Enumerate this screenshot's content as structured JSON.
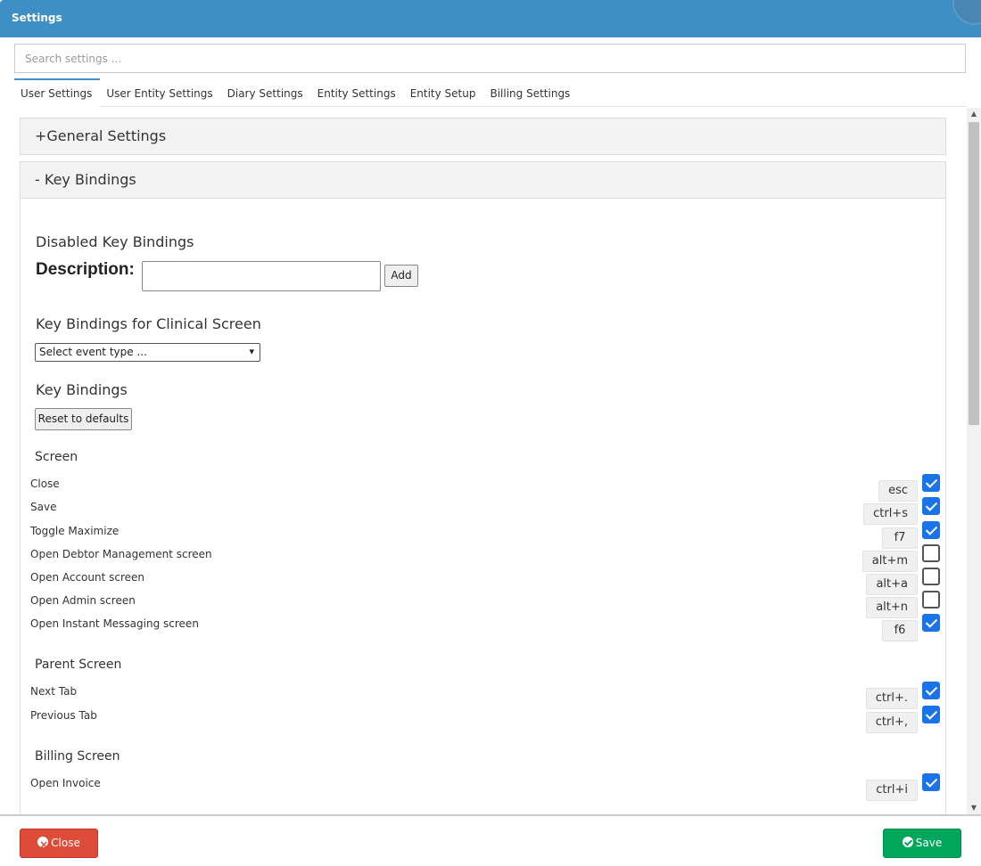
{
  "window": {
    "title": "Settings"
  },
  "search": {
    "placeholder": "Search settings ..."
  },
  "tabs": [
    {
      "label": "User Settings",
      "active": true
    },
    {
      "label": "User Entity Settings",
      "active": false
    },
    {
      "label": "Diary Settings",
      "active": false
    },
    {
      "label": "Entity Settings",
      "active": false
    },
    {
      "label": "Entity Setup",
      "active": false
    },
    {
      "label": "Billing Settings",
      "active": false
    }
  ],
  "panels": {
    "general": {
      "toggle": "+",
      "title": "General Settings"
    },
    "key_bindings": {
      "toggle": "-",
      "title": "Key Bindings"
    }
  },
  "disabled": {
    "heading": "Disabled Key Bindings",
    "description_label": "Description:",
    "description_value": "",
    "add_label": "Add"
  },
  "clinical": {
    "heading": "Key Bindings for Clinical Screen",
    "select_value": "Select event type ..."
  },
  "bindings": {
    "heading": "Key Bindings",
    "reset_label": "Reset to defaults",
    "sections": [
      {
        "label": "Screen",
        "items": [
          {
            "name": "Close",
            "key": "esc",
            "enabled": true
          },
          {
            "name": "Save",
            "key": "ctrl+s",
            "enabled": true
          },
          {
            "name": "Toggle Maximize",
            "key": "f7",
            "enabled": true
          },
          {
            "name": "Open Debtor Management screen",
            "key": "alt+m",
            "enabled": false
          },
          {
            "name": "Open Account screen",
            "key": "alt+a",
            "enabled": false
          },
          {
            "name": "Open Admin screen",
            "key": "alt+n",
            "enabled": false
          },
          {
            "name": "Open Instant Messaging screen",
            "key": "f6",
            "enabled": true
          }
        ]
      },
      {
        "label": "Parent Screen",
        "items": [
          {
            "name": "Next Tab",
            "key": "ctrl+.",
            "enabled": true
          },
          {
            "name": "Previous Tab",
            "key": "ctrl+,",
            "enabled": true
          }
        ]
      },
      {
        "label": "Billing Screen",
        "items": [
          {
            "name": "Open Invoice",
            "key": "ctrl+i",
            "enabled": true
          }
        ]
      }
    ]
  },
  "footer": {
    "close_label": "Close",
    "save_label": "Save"
  },
  "colors": {
    "titlebar": "#3d8fc6",
    "close": "#dd4b39",
    "save": "#00a65a",
    "checkbox": "#1a73e8"
  }
}
